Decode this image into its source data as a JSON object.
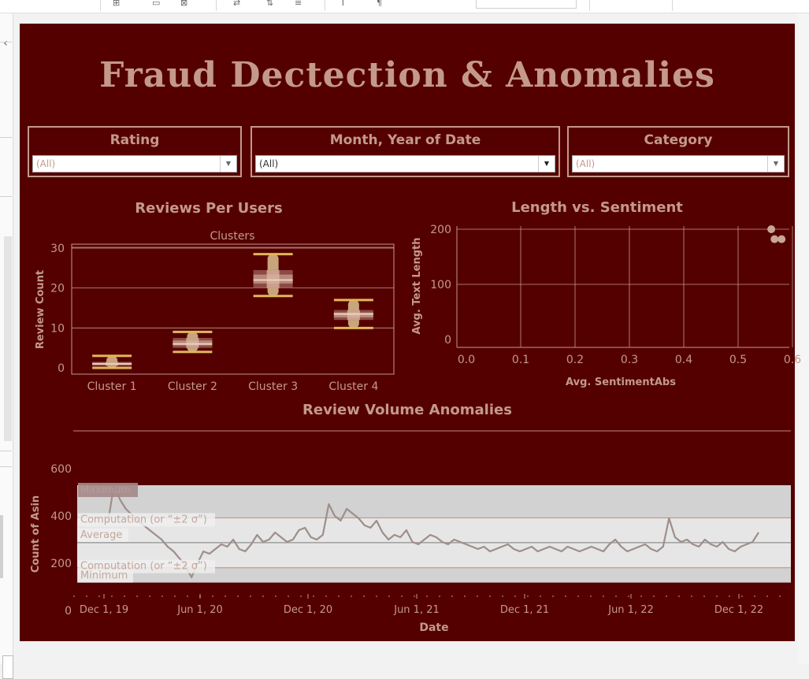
{
  "dashboard": {
    "title": "Fraud Dectection & Anomalies",
    "background": "#540000",
    "accent": "#c4998a"
  },
  "filters": [
    {
      "label": "Rating",
      "value": "(All)"
    },
    {
      "label": "Month, Year of Date",
      "value": "(All)"
    },
    {
      "label": "Category",
      "value": "(All)"
    }
  ],
  "toolbar": {
    "icons": [
      "add-sheet-icon",
      "duplicate-icon",
      "clear-sheet-icon",
      "swap-icon",
      "sort-icon",
      "group-icon",
      "label-icon",
      "format-icon"
    ]
  },
  "reviews_chart": {
    "title": "Reviews Per Users",
    "header": "Clusters",
    "ylabel": "Review Count",
    "y_ticks": [
      "30",
      "20",
      "10",
      "0"
    ]
  },
  "sentiment_chart": {
    "title": "Length vs. Sentiment",
    "xlabel": "Avg. SentimentAbs",
    "ylabel": "Avg. Text Length",
    "x_ticks": [
      "0.0",
      "0.1",
      "0.2",
      "0.3",
      "0.4",
      "0.5",
      "0.6"
    ],
    "y_ticks": [
      "200",
      "100",
      "0"
    ]
  },
  "volume_chart": {
    "title": "Review Volume Anomalies",
    "xlabel": "Date",
    "ylabel": "Count of Asin",
    "y_ticks": [
      "600",
      "400",
      "200",
      "0"
    ],
    "x_ticks": [
      "Dec 1, 19",
      "Jun 1, 20",
      "Dec 1, 20",
      "Jun 1, 21",
      "Dec 1, 21",
      "Jun 1, 22",
      "Dec 1, 22"
    ],
    "bands": {
      "maximum": "Maximum",
      "upper": "Computation (or “±2 σ”)",
      "average": "Average",
      "lower": "Computation (or “±2 σ”)",
      "minimum": "Minimum"
    }
  },
  "chart_data": [
    {
      "type": "box",
      "title": "Reviews Per Users",
      "categories": [
        "Cluster 1",
        "Cluster 2",
        "Cluster 3",
        "Cluster 4"
      ],
      "xlabel": "Clusters",
      "ylabel": "Review Count",
      "ylim": [
        0,
        32
      ],
      "boxes": [
        {
          "min": 0,
          "q1": 0.5,
          "median": 1,
          "q3": 1.5,
          "max": 3
        },
        {
          "min": 4,
          "q1": 5,
          "median": 6,
          "q3": 7.5,
          "max": 9
        },
        {
          "min": 18,
          "q1": 20,
          "median": 22,
          "q3": 24.5,
          "max": 28.5
        },
        {
          "min": 10,
          "q1": 12,
          "median": 13.5,
          "q3": 14.5,
          "max": 17
        }
      ],
      "grid": true
    },
    {
      "type": "scatter",
      "title": "Length vs. Sentiment",
      "xlabel": "Avg. SentimentAbs",
      "ylabel": "Avg. Text Length",
      "xlim": [
        0,
        0.62
      ],
      "ylim": [
        -15,
        215
      ],
      "points": [
        {
          "x": 0.561,
          "y": 200
        },
        {
          "x": 0.567,
          "y": 182
        },
        {
          "x": 0.58,
          "y": 182
        }
      ],
      "grid": true
    },
    {
      "type": "line",
      "title": "Review Volume Anomalies",
      "xlabel": "Date",
      "ylabel": "Count of Asin",
      "x_range": [
        "2019-11-15",
        "2022-12-31"
      ],
      "ylim": [
        0,
        630
      ],
      "reference": {
        "maximum": 530,
        "upper": 392,
        "average": 287,
        "lower": 181,
        "minimum": 118
      },
      "series": [
        {
          "values": [
            370,
            530,
            470,
            430,
            405,
            380,
            360,
            340,
            320,
            300,
            270,
            250,
            220,
            190,
            140,
            200,
            250,
            240,
            260,
            280,
            270,
            300,
            260,
            250,
            280,
            320,
            290,
            300,
            330,
            310,
            290,
            300,
            340,
            350,
            310,
            300,
            320,
            450,
            400,
            380,
            430,
            410,
            390,
            360,
            350,
            380,
            330,
            300,
            320,
            310,
            340,
            290,
            280,
            300,
            320,
            310,
            290,
            280,
            300,
            290,
            280,
            270,
            260,
            270,
            250,
            260,
            270,
            280,
            260,
            250,
            260,
            270,
            250,
            260,
            270,
            260,
            250,
            270,
            260,
            250,
            260,
            270,
            260,
            250,
            280,
            300,
            270,
            250,
            260,
            270,
            280,
            260,
            250,
            270,
            390,
            310,
            290,
            300,
            280,
            270,
            300,
            280,
            270,
            290,
            260,
            250,
            270,
            280,
            290,
            330
          ],
          "color": "#9e8f8a"
        }
      ]
    }
  ]
}
